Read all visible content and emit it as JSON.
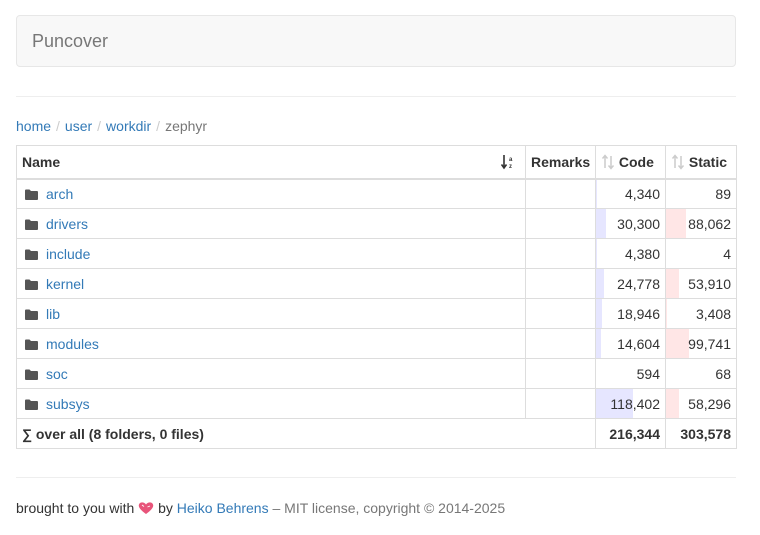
{
  "navbar": {
    "brand": "Puncover"
  },
  "breadcrumb": [
    {
      "label": "home",
      "link": true
    },
    {
      "label": "user",
      "link": true
    },
    {
      "label": "workdir",
      "link": true
    },
    {
      "label": "zephyr",
      "link": false
    }
  ],
  "table": {
    "headers": {
      "name": "Name",
      "remarks": "Remarks",
      "code": "Code",
      "static": "Static"
    },
    "rows": [
      {
        "name": "arch",
        "code": "4,340",
        "static": "89",
        "code_fraction": 0.02,
        "static_fraction": 0.0
      },
      {
        "name": "drivers",
        "code": "30,300",
        "static": "88,062",
        "code_fraction": 0.14,
        "static_fraction": 0.29
      },
      {
        "name": "include",
        "code": "4,380",
        "static": "4",
        "code_fraction": 0.02,
        "static_fraction": 0.0
      },
      {
        "name": "kernel",
        "code": "24,778",
        "static": "53,910",
        "code_fraction": 0.11,
        "static_fraction": 0.18
      },
      {
        "name": "lib",
        "code": "18,946",
        "static": "3,408",
        "code_fraction": 0.09,
        "static_fraction": 0.01
      },
      {
        "name": "modules",
        "code": "14,604",
        "static": "99,741",
        "code_fraction": 0.07,
        "static_fraction": 0.33
      },
      {
        "name": "soc",
        "code": "594",
        "static": "68",
        "code_fraction": 0.0,
        "static_fraction": 0.0
      },
      {
        "name": "subsys",
        "code": "118,402",
        "static": "58,296",
        "code_fraction": 0.54,
        "static_fraction": 0.19
      }
    ],
    "total": {
      "label": "∑ over all (8 folders, 0 files)",
      "code": "216,344",
      "static": "303,578"
    }
  },
  "footer": {
    "prefix": "brought to you with",
    "by": "by",
    "author": "Heiko Behrens",
    "suffix": "– MIT license, copyright © 2014-2025"
  },
  "colors": {
    "link": "#337ab7",
    "code_bar": "#e6e6ff",
    "static_bar": "#ffe6e6",
    "heart": "#e8547a"
  }
}
